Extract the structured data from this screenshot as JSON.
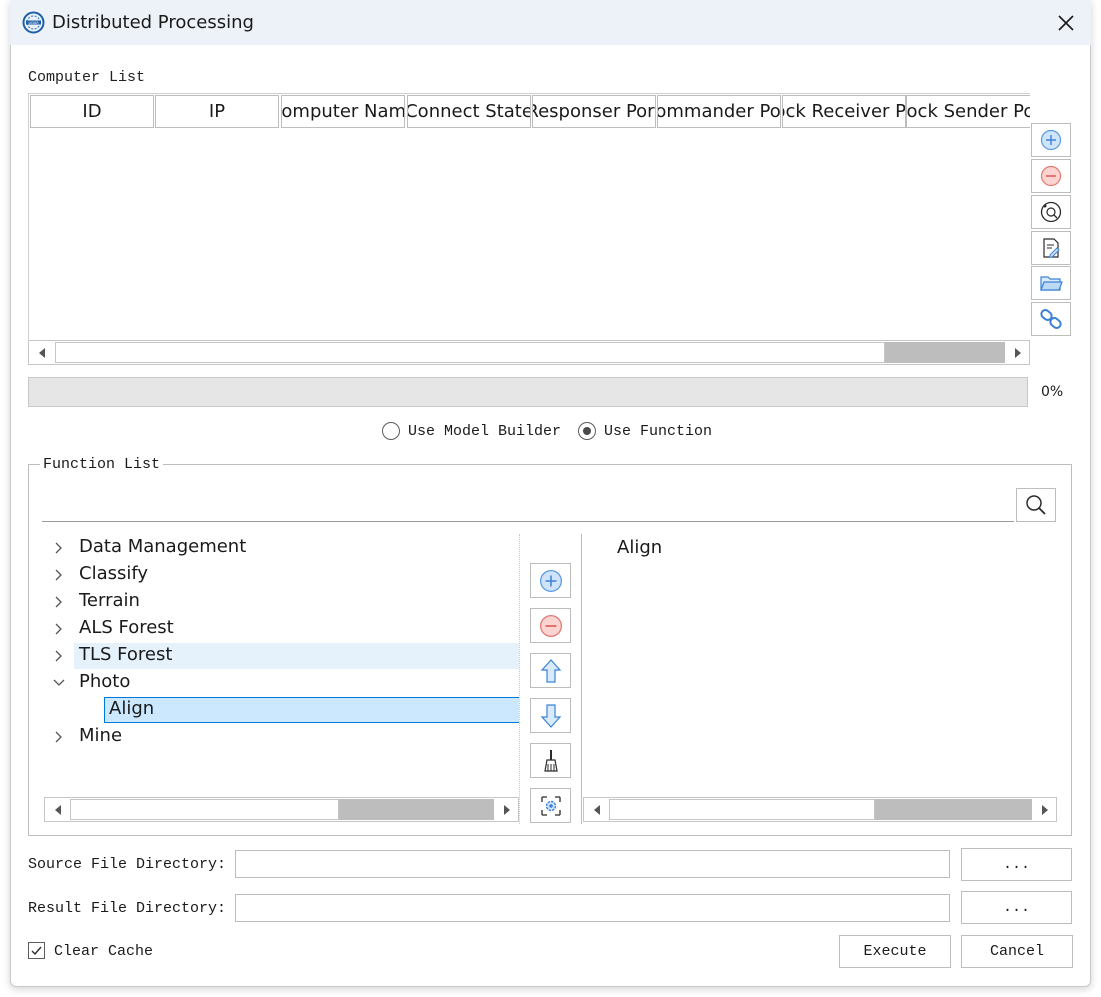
{
  "window": {
    "title": "Distributed Processing",
    "logo_icon": "app-logo-icon",
    "close_icon": "close-icon"
  },
  "computer_list": {
    "label": "Computer List",
    "columns": [
      "ID",
      "IP",
      "Computer Name",
      "Connect State",
      "Responser Port",
      "Commander Port",
      "Block Receiver Port",
      "Block Sender Port"
    ],
    "tools": [
      "add-icon",
      "remove-icon",
      "scan-icon",
      "edit-icon",
      "folder-open-icon",
      "link-icon"
    ]
  },
  "progress": {
    "value": 0,
    "label": "0%"
  },
  "mode": {
    "options": [
      "Use Model Builder",
      "Use Function"
    ],
    "selected": "Use Function"
  },
  "function_list": {
    "label": "Function List",
    "search_value": "",
    "tree": [
      {
        "label": "Data Management",
        "expanded": false
      },
      {
        "label": "Classify",
        "expanded": false
      },
      {
        "label": "Terrain",
        "expanded": false
      },
      {
        "label": "ALS Forest",
        "expanded": false
      },
      {
        "label": "TLS Forest",
        "expanded": false,
        "hover": true
      },
      {
        "label": "Photo",
        "expanded": true,
        "children": [
          {
            "label": "Align",
            "selected": true
          }
        ]
      },
      {
        "label": "Mine",
        "expanded": false
      }
    ],
    "middle_tools": [
      "add-icon",
      "remove-icon",
      "arrow-up-icon",
      "arrow-down-icon",
      "brush-icon",
      "settings-icon"
    ],
    "selected_functions": [
      "Align"
    ]
  },
  "directories": {
    "source": {
      "label": "Source File Directory:",
      "value": "",
      "browse": "..."
    },
    "result": {
      "label": "Result File Directory:",
      "value": "",
      "browse": "..."
    }
  },
  "options": {
    "clear_cache_label": "Clear Cache",
    "clear_cache_checked": true
  },
  "actions": {
    "execute": "Execute",
    "cancel": "Cancel"
  }
}
